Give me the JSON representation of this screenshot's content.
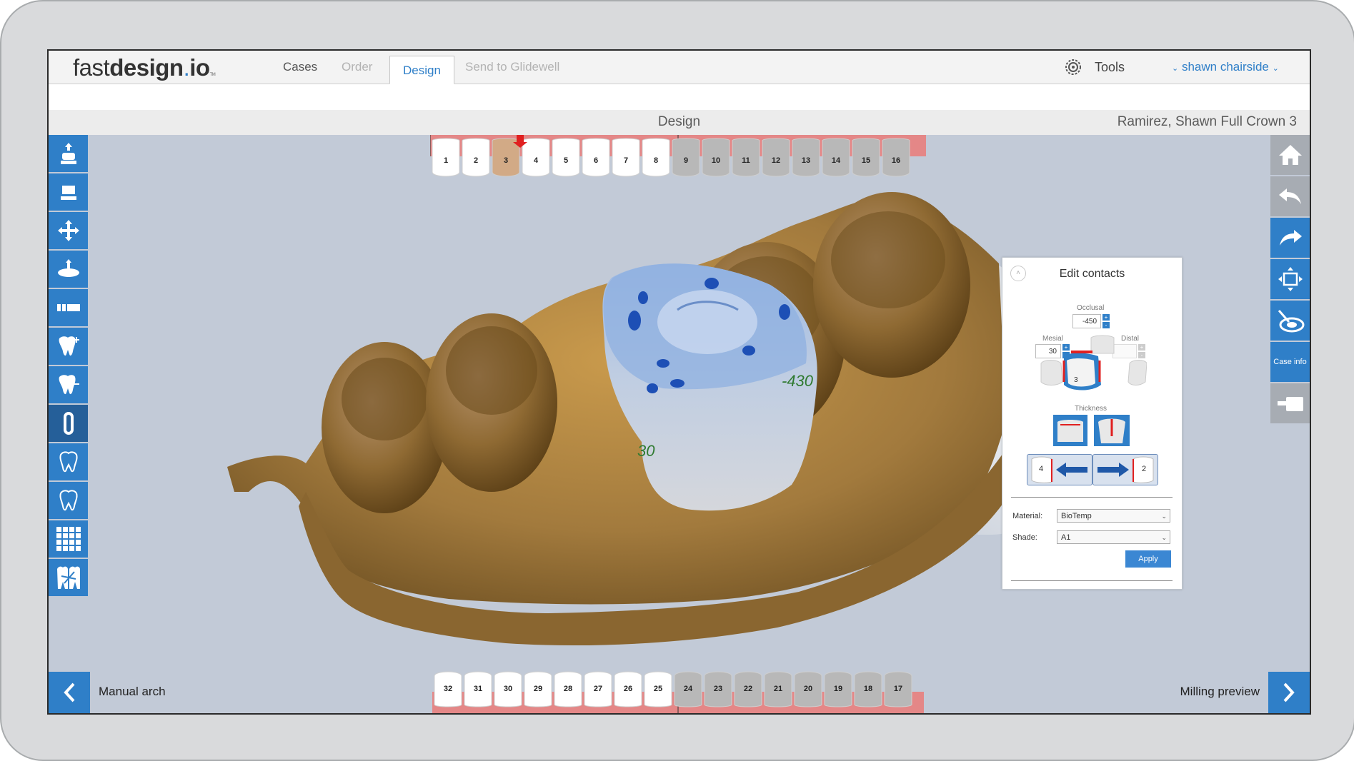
{
  "app": {
    "logo": {
      "light": "fast",
      "bold": "design",
      "dot": ".",
      "tail": "io",
      "tm": "TM"
    }
  },
  "nav": {
    "tabs": [
      {
        "label": "Cases"
      },
      {
        "label": "Order"
      },
      {
        "label": "Design"
      },
      {
        "label": "Send to Glidewell"
      }
    ],
    "tools_label": "Tools",
    "user": "shawn chairside"
  },
  "titlebar": {
    "center": "Design",
    "case_name": "Ramirez, Shawn Full Crown 3"
  },
  "arches": {
    "upper": [
      "1",
      "2",
      "3",
      "4",
      "5",
      "6",
      "7",
      "8",
      "9",
      "10",
      "11",
      "12",
      "13",
      "14",
      "15",
      "16"
    ],
    "lower": [
      "32",
      "31",
      "30",
      "29",
      "28",
      "27",
      "26",
      "25",
      "24",
      "23",
      "22",
      "21",
      "20",
      "19",
      "18",
      "17"
    ],
    "selected_tooth": "3"
  },
  "left_tools": [
    "extrude-icon",
    "margin-icon",
    "move-icon",
    "insertion-axis-icon",
    "bar-icon",
    "add-tooth-icon",
    "remove-tooth-icon",
    "toggle-icon",
    "tooth-outline-icon",
    "tooth-outline-2-icon",
    "grid-icon",
    "cut-icon"
  ],
  "right_tools": {
    "case_info_label": "Case info"
  },
  "annotations": {
    "mesial_value": "30",
    "occlusal_value": "-430"
  },
  "edit_contacts": {
    "title": "Edit contacts",
    "occlusal_label": "Occlusal",
    "occlusal_value": "-450",
    "mesial_label": "Mesial",
    "mesial_value": "30",
    "distal_label": "Distal",
    "distal_value": "",
    "tooth_number": "3",
    "thickness_label": "Thickness",
    "prev_tooth": "4",
    "next_tooth": "2",
    "material_label": "Material:",
    "material_value": "BioTemp",
    "shade_label": "Shade:",
    "shade_value": "A1",
    "apply_label": "Apply"
  },
  "bottom": {
    "prev_label": "Manual arch",
    "next_label": "Milling preview"
  },
  "colors": {
    "accent": "#2f7fc8",
    "gum": "#e48787",
    "model": "#a27a3d",
    "crown": "#b5cbe7",
    "viewport_bg": "#c2cad7"
  }
}
